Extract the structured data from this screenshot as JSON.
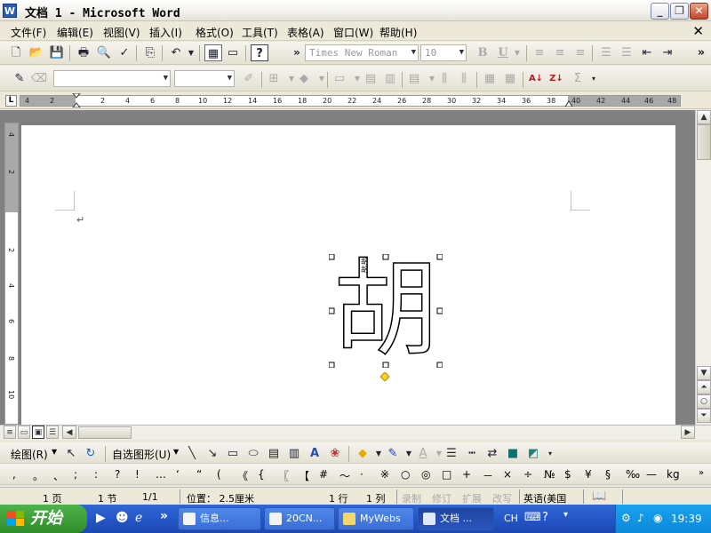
{
  "window": {
    "title": "文档 1 - Microsoft Word",
    "icon_letter": "W",
    "minimize": "_",
    "restore": "❐",
    "close": "✕"
  },
  "menu": {
    "items": [
      "文件(F)",
      "编辑(E)",
      "视图(V)",
      "插入(I)",
      "格式(O)",
      "工具(T)",
      "表格(A)",
      "窗口(W)",
      "帮助(H)"
    ],
    "close_doc": "✕"
  },
  "formatting": {
    "font_name": "Times New Roman",
    "font_size": "10",
    "bold": "B",
    "underline": "U"
  },
  "ruler": {
    "ticks": [
      "4",
      "2",
      "2",
      "4",
      "6",
      "8",
      "10",
      "12",
      "14",
      "16",
      "18",
      "20",
      "22",
      "24",
      "26",
      "28",
      "30",
      "32",
      "34",
      "36",
      "38",
      "40",
      "42",
      "44",
      "46",
      "48"
    ],
    "vticks": [
      "4",
      "2",
      "2",
      "4",
      "6",
      "8",
      "10"
    ]
  },
  "document": {
    "paragraph_mark": "↵",
    "word_art_text": "胡",
    "inner_text": "胡胡",
    "handle_color": "#ffd21f"
  },
  "drawing_toolbar": {
    "draw_label": "绘图(R)",
    "autoshapes_label": "自选图形(U)"
  },
  "symbol_toolbar": {
    "symbols": [
      ",",
      "。",
      "、",
      ";",
      ":",
      "?",
      "!",
      "…",
      "‘",
      "“",
      "(",
      "《",
      "{",
      "〖",
      "【",
      "#",
      "～",
      "·",
      "※",
      "○",
      "◎",
      "□",
      "+",
      "－",
      "×",
      "÷",
      "№",
      "$",
      "¥",
      "§",
      "‰",
      "—",
      "kg"
    ]
  },
  "status": {
    "page": "1 页",
    "section": "1 节",
    "pages": "1/1",
    "position": "位置： 2.5厘米",
    "line": "1 行",
    "column": "1 列",
    "rec": "录制",
    "trk": "修订",
    "ext": "扩展",
    "ovr": "改写",
    "language": "英语(美国"
  },
  "taskbar": {
    "start": "开始",
    "tasks": [
      "信息...",
      "20CN...",
      "MyWebs",
      "文档 ..."
    ],
    "ime": "CH",
    "clock": "19:39"
  },
  "colors": {
    "title_active": "#2a5db0",
    "taskbar": "#2456c7",
    "start_green": "#3d9d37",
    "tray": "#0f94e0"
  }
}
